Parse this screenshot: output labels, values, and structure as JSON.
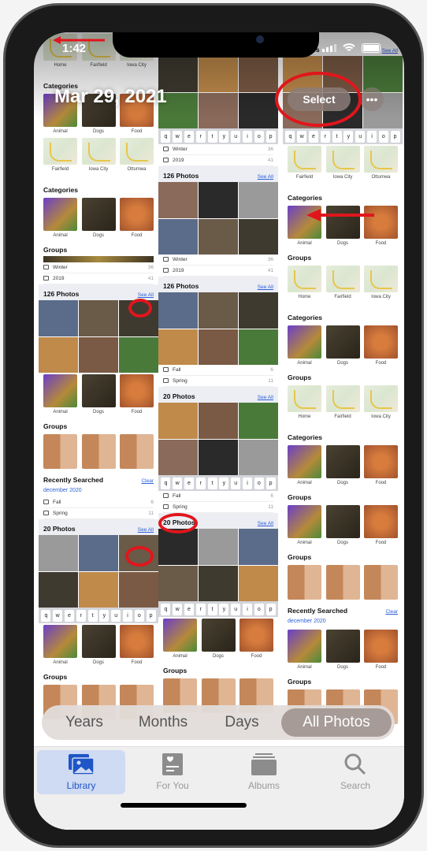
{
  "status": {
    "time": "1:42"
  },
  "header": {
    "title": "Mar 29, 2021",
    "select_label": "Select",
    "more_label": "•••"
  },
  "colors": {
    "accent": "#1f56c6",
    "annotation": "#e0161c",
    "link": "#2c5fd8"
  },
  "columns": [
    {
      "blocks": [
        {
          "type": "maps",
          "items": [
            "Home",
            "Fairfield",
            "Iowa City"
          ]
        },
        {
          "type": "header",
          "title": "Categories"
        },
        {
          "type": "thumbs",
          "items": [
            "Animal",
            "Dogs",
            "Food"
          ]
        },
        {
          "type": "maps",
          "items": [
            "Fairfield",
            "Iowa City",
            "Ottumwa"
          ]
        },
        {
          "type": "header",
          "title": "Categories"
        },
        {
          "type": "thumbs",
          "items": [
            "Animal",
            "Dogs",
            "Food"
          ]
        },
        {
          "type": "header",
          "title": "Groups"
        },
        {
          "type": "strip"
        },
        {
          "type": "list",
          "items": [
            {
              "label": "Winter",
              "count": "36"
            },
            {
              "label": "2019",
              "count": "41"
            }
          ]
        },
        {
          "type": "header",
          "title": "126 Photos",
          "link": "See All",
          "gray": true
        },
        {
          "type": "photos"
        },
        {
          "type": "thumbs",
          "items": [
            "Animal",
            "Dogs",
            "Food"
          ]
        },
        {
          "type": "header",
          "title": "Groups"
        },
        {
          "type": "faces"
        },
        {
          "type": "header",
          "title": "Recently Searched",
          "link": "Clear"
        },
        {
          "type": "recent",
          "text": "december 2020"
        },
        {
          "type": "list",
          "items": [
            {
              "label": "Fall",
              "count": "6"
            },
            {
              "label": "Spring",
              "count": "11"
            }
          ]
        },
        {
          "type": "header",
          "title": "20 Photos",
          "link": "See All",
          "gray": true
        },
        {
          "type": "photos"
        },
        {
          "type": "keyboard"
        },
        {
          "type": "thumbs",
          "items": [
            "Animal",
            "Dogs",
            "Food"
          ]
        },
        {
          "type": "header",
          "title": "Groups"
        },
        {
          "type": "faces"
        }
      ]
    },
    {
      "blocks": [
        {
          "type": "gap"
        },
        {
          "type": "header",
          "title": "30 Photos",
          "link": "See All",
          "gray": true
        },
        {
          "type": "photos"
        },
        {
          "type": "keyboard"
        },
        {
          "type": "list",
          "items": [
            {
              "label": "Winter",
              "count": "36"
            },
            {
              "label": "2019",
              "count": "41"
            }
          ]
        },
        {
          "type": "header",
          "title": "126 Photos",
          "link": "See All",
          "gray": true
        },
        {
          "type": "photos"
        },
        {
          "type": "list",
          "items": [
            {
              "label": "Winter",
              "count": "36"
            },
            {
              "label": "2019",
              "count": "41"
            }
          ]
        },
        {
          "type": "header",
          "title": "126 Photos",
          "link": "See All",
          "gray": true
        },
        {
          "type": "photos"
        },
        {
          "type": "list",
          "items": [
            {
              "label": "Fall",
              "count": "6"
            },
            {
              "label": "Spring",
              "count": "11"
            }
          ]
        },
        {
          "type": "header",
          "title": "20 Photos",
          "link": "See All",
          "gray": true
        },
        {
          "type": "photos"
        },
        {
          "type": "keyboard"
        },
        {
          "type": "list",
          "items": [
            {
              "label": "Fall",
              "count": "6"
            },
            {
              "label": "Spring",
              "count": "11"
            }
          ]
        },
        {
          "type": "header",
          "title": "20 Photos",
          "link": "See All",
          "gray": true
        },
        {
          "type": "photos"
        },
        {
          "type": "keyboard"
        },
        {
          "type": "thumbs",
          "items": [
            "Animal",
            "Dogs",
            "Food"
          ]
        },
        {
          "type": "header",
          "title": "Groups"
        },
        {
          "type": "faces"
        }
      ]
    },
    {
      "blocks": [
        {
          "type": "gap"
        },
        {
          "type": "header",
          "title": "30 Photos",
          "link": "See All"
        },
        {
          "type": "photos"
        },
        {
          "type": "keyboard"
        },
        {
          "type": "maps",
          "items": [
            "Fairfield",
            "Iowa City",
            "Ottumwa"
          ]
        },
        {
          "type": "header",
          "title": "Categories"
        },
        {
          "type": "thumbs",
          "items": [
            "Animal",
            "Dogs",
            "Food"
          ]
        },
        {
          "type": "header",
          "title": "Groups"
        },
        {
          "type": "maps",
          "items": [
            "Home",
            "Fairfield",
            "Iowa City"
          ]
        },
        {
          "type": "header",
          "title": "Categories"
        },
        {
          "type": "thumbs",
          "items": [
            "Animal",
            "Dogs",
            "Food"
          ]
        },
        {
          "type": "header",
          "title": "Groups"
        },
        {
          "type": "maps",
          "items": [
            "Home",
            "Fairfield",
            "Iowa City"
          ]
        },
        {
          "type": "header",
          "title": "Categories"
        },
        {
          "type": "thumbs",
          "items": [
            "Animal",
            "Dogs",
            "Food"
          ]
        },
        {
          "type": "header",
          "title": "Groups"
        },
        {
          "type": "thumbs",
          "items": [
            "Animal",
            "Dogs",
            "Food"
          ]
        },
        {
          "type": "header",
          "title": "Groups"
        },
        {
          "type": "faces"
        },
        {
          "type": "header",
          "title": "Recently Searched",
          "link": "Clear"
        },
        {
          "type": "recent",
          "text": "december 2020"
        },
        {
          "type": "thumbs",
          "items": [
            "Animal",
            "Dogs",
            "Food"
          ]
        },
        {
          "type": "header",
          "title": "Groups"
        },
        {
          "type": "faces"
        }
      ]
    }
  ],
  "keyboard_keys": [
    "q",
    "w",
    "e",
    "r",
    "t",
    "y",
    "u",
    "i",
    "o",
    "p"
  ],
  "segments": [
    {
      "label": "Years",
      "selected": false
    },
    {
      "label": "Months",
      "selected": false
    },
    {
      "label": "Days",
      "selected": false
    },
    {
      "label": "All Photos",
      "selected": true
    }
  ],
  "tabs": [
    {
      "label": "Library",
      "icon": "photo-library-icon",
      "selected": true
    },
    {
      "label": "For You",
      "icon": "for-you-icon",
      "selected": false
    },
    {
      "label": "Albums",
      "icon": "albums-icon",
      "selected": false
    },
    {
      "label": "Search",
      "icon": "search-icon",
      "selected": false
    }
  ]
}
